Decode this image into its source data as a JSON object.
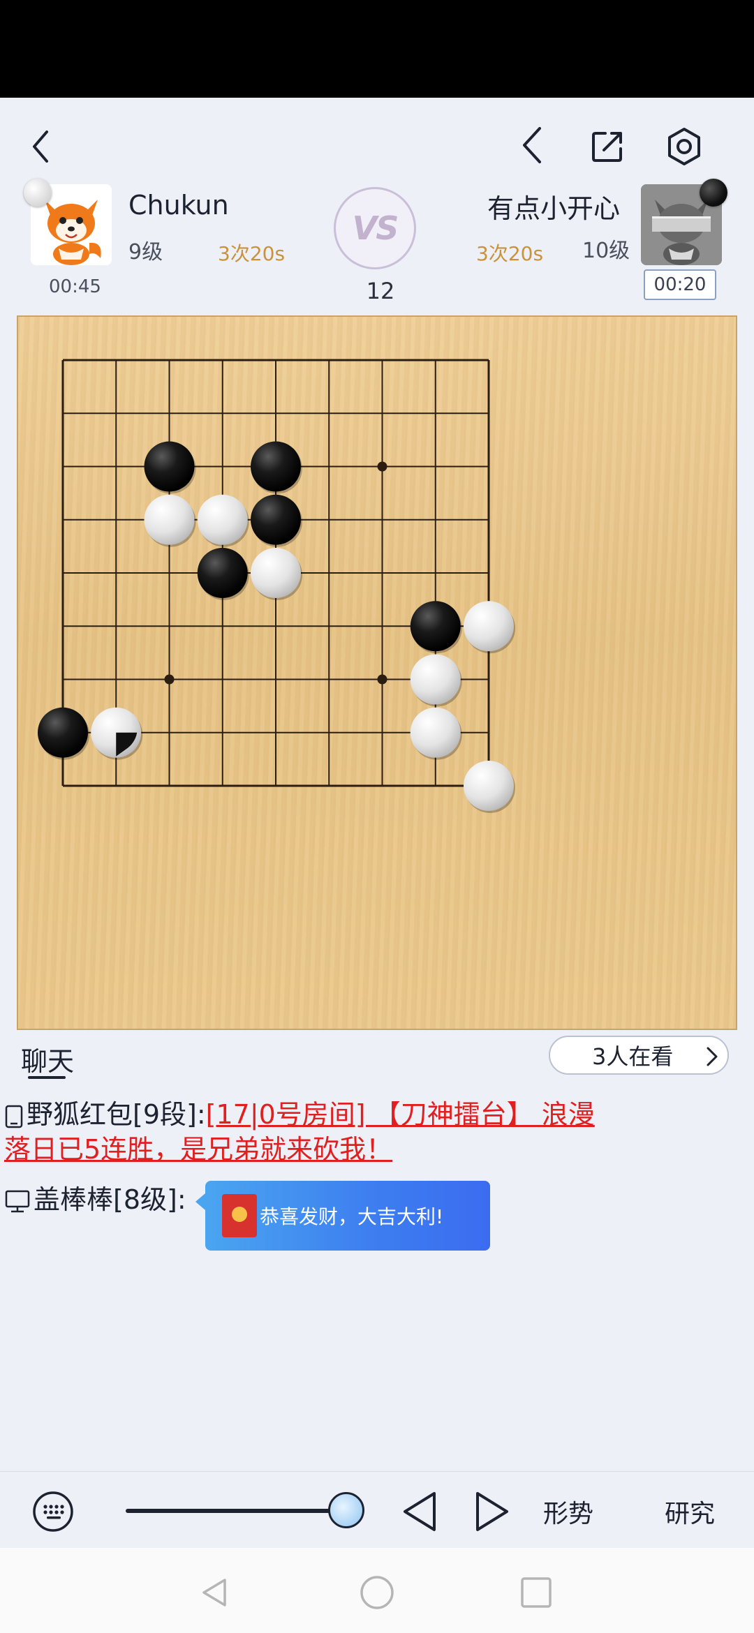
{
  "header": {
    "back_icon": "chevron-left-icon",
    "prev_icon": "chevron-left-icon",
    "share_icon": "share-icon",
    "settings_icon": "gear-icon"
  },
  "players": {
    "left": {
      "name": "Chukun",
      "rank": "9级",
      "byoyomi": "3次20s",
      "clock": "00:45",
      "stone": "white"
    },
    "right": {
      "name": "有点小开心",
      "rank": "10级",
      "byoyomi": "3次20s",
      "clock": "00:20",
      "stone": "black"
    }
  },
  "vs_label": "VS",
  "move_number": "12",
  "board": {
    "size": 9,
    "star_points": [
      [
        6,
        2
      ],
      [
        2,
        6
      ],
      [
        6,
        6
      ]
    ],
    "stones": [
      {
        "c": "B",
        "x": 2,
        "y": 2
      },
      {
        "c": "B",
        "x": 4,
        "y": 2
      },
      {
        "c": "W",
        "x": 2,
        "y": 3
      },
      {
        "c": "W",
        "x": 3,
        "y": 3
      },
      {
        "c": "B",
        "x": 4,
        "y": 3
      },
      {
        "c": "B",
        "x": 3,
        "y": 4
      },
      {
        "c": "W",
        "x": 4,
        "y": 4
      },
      {
        "c": "B",
        "x": 7,
        "y": 5
      },
      {
        "c": "W",
        "x": 8,
        "y": 5
      },
      {
        "c": "W",
        "x": 7,
        "y": 6
      },
      {
        "c": "B",
        "x": 0,
        "y": 7
      },
      {
        "c": "W",
        "x": 1,
        "y": 7,
        "last": true
      },
      {
        "c": "W",
        "x": 7,
        "y": 7
      },
      {
        "c": "W",
        "x": 8,
        "y": 8
      }
    ]
  },
  "chat": {
    "tab_label": "聊天",
    "viewers": "3人在看",
    "messages": [
      {
        "sender": "野狐红包[9段]:",
        "line1": "[17|0号房间] 【刀神擂台】 浪漫",
        "line2": "落日已5连胜，是兄弟就来砍我！"
      },
      {
        "sender": "盖棒棒[8级]:",
        "packet_text": "恭喜发财，大吉大利!"
      }
    ]
  },
  "toolbar": {
    "keyboard_icon": "keyboard-icon",
    "slider_value": 1.0,
    "prev_move_icon": "triangle-left-icon",
    "next_move_icon": "triangle-right-icon",
    "situation_label": "形势",
    "research_label": "研究"
  }
}
